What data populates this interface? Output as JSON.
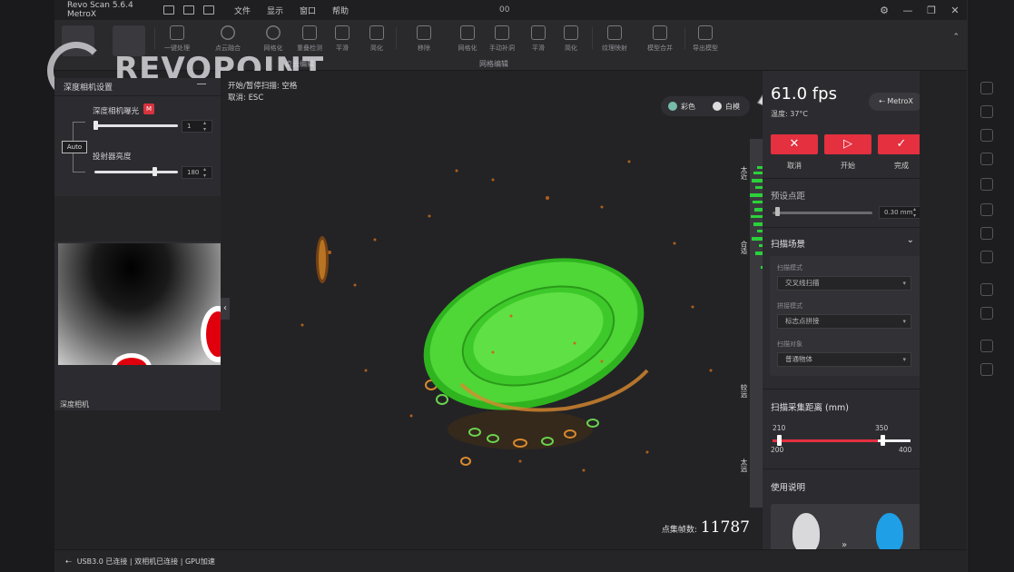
{
  "window": {
    "title": "Revo Scan 5.6.4 MetroX",
    "frame_number": "00",
    "menu": [
      "文件",
      "显示",
      "窗口",
      "帮助"
    ],
    "controls": [
      "⚙",
      "—",
      "❐",
      "✕"
    ]
  },
  "logo": "REVOPOINT",
  "toolbar": {
    "tools": [
      "一键处理",
      "点云融合",
      "网格化",
      "重叠检测",
      "平滑",
      "简化",
      "移除",
      "网格化",
      "手动补洞",
      "平滑",
      "简化",
      "纹理映射",
      "模型合并",
      "导出模型"
    ],
    "groups": [
      "点云编辑",
      "网格编辑"
    ]
  },
  "left_panel": {
    "title": "深度相机设置",
    "exposure_label": "深度相机曝光",
    "exposure_badge": "M",
    "exposure_value": "1",
    "exposure_level": 0.01,
    "auto_label": "Auto",
    "laser_label": "投射器亮度",
    "laser_value": "180",
    "laser_level": 0.72,
    "preview_label": "深度相机"
  },
  "viewport": {
    "hint_scan": "开始/暂停扫描: 空格",
    "hint_cancel": "取消: ESC",
    "mode_color": "彩色",
    "mode_white": "白模",
    "histogram_ticks": [
      "200mm",
      "230mm",
      "277mm",
      "370mm",
      "400mm"
    ],
    "histogram_labels": [
      "太近",
      "合适",
      "较远",
      "太远"
    ],
    "points_label": "点集帧数:",
    "points_count": "11787"
  },
  "right_panel": {
    "fps": "61.0 fps",
    "temperature": "温度: 37°C",
    "device": "MetroX",
    "buttons": {
      "cancel_label": "取消",
      "start_label": "开始",
      "finish_label": "完成"
    },
    "point_distance_label": "预设点距",
    "point_distance_value": "0.30 mm",
    "scan_settings_label": "扫描场景",
    "scan_mode_label": "扫描模式",
    "scan_mode_value": "交叉线扫描",
    "tracking_label": "拼接模式",
    "tracking_value": "标志点拼接",
    "object_label": "扫描对象",
    "object_value": "普通物体",
    "range_label": "扫描采集距离 (mm)",
    "range_low": "210",
    "range_high": "350",
    "range_min": "200",
    "range_max": "400",
    "guide_label": "使用说明"
  },
  "statusbar": {
    "text": "USB3.0 已连接 | 双相机已连接 | GPU加速"
  },
  "colors": {
    "accent_red": "#e4303f",
    "scan_green": "#3ec92a",
    "histogram_green": "#2bd13a"
  }
}
